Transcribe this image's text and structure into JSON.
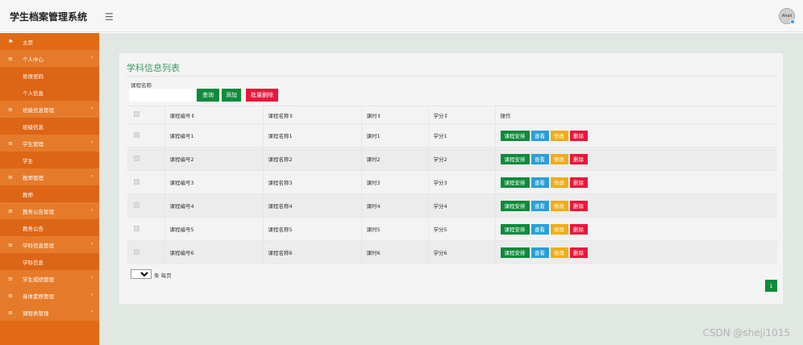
{
  "header": {
    "app_title": "学生档案管理系统",
    "menu_icon": "hamburger-icon",
    "avatar_text": "Ahaii"
  },
  "sidebar": {
    "items": [
      {
        "type": "home",
        "label": "主页",
        "icon": "flag-icon"
      },
      {
        "type": "group",
        "label": "个人中心",
        "icon": "menu-icon"
      },
      {
        "type": "sub",
        "label": "修改密码"
      },
      {
        "type": "sub",
        "label": "个人信息"
      },
      {
        "type": "group",
        "label": "班级信息管理",
        "icon": "menu-icon"
      },
      {
        "type": "sub",
        "label": "班级信息"
      },
      {
        "type": "group",
        "label": "学生管理",
        "icon": "menu-icon"
      },
      {
        "type": "sub",
        "label": "学生"
      },
      {
        "type": "group",
        "label": "教师管理",
        "icon": "menu-icon"
      },
      {
        "type": "sub",
        "label": "教师"
      },
      {
        "type": "group",
        "label": "教务公告管理",
        "icon": "menu-icon"
      },
      {
        "type": "sub",
        "label": "教务公告"
      },
      {
        "type": "group",
        "label": "学科信息管理",
        "icon": "menu-icon"
      },
      {
        "type": "sub",
        "label": "学科信息"
      },
      {
        "type": "group",
        "label": "学生成绩管理",
        "icon": "menu-icon"
      },
      {
        "type": "group",
        "label": "身体素质管理",
        "icon": "menu-icon"
      },
      {
        "type": "group",
        "label": "课程表管理",
        "icon": "menu-icon"
      }
    ]
  },
  "main": {
    "title": "学科信息列表",
    "search": {
      "label": "课程名称",
      "value": "",
      "placeholder": ""
    },
    "buttons": {
      "query": "查询",
      "add": "添加",
      "batch_delete": "批量删除"
    },
    "table": {
      "columns": [
        "",
        "课程编号⇕",
        "课程名称⇕",
        "课时⇕",
        "学分⇕",
        "操作"
      ],
      "rows": [
        {
          "code": "课程编号1",
          "name": "课程名称1",
          "hours": "课时1",
          "credit": "学分1"
        },
        {
          "code": "课程编号2",
          "name": "课程名称2",
          "hours": "课时2",
          "credit": "学分2"
        },
        {
          "code": "课程编号3",
          "name": "课程名称3",
          "hours": "课时3",
          "credit": "学分3"
        },
        {
          "code": "课程编号4",
          "name": "课程名称4",
          "hours": "课时4",
          "credit": "学分4"
        },
        {
          "code": "课程编号5",
          "name": "课程名称5",
          "hours": "课时5",
          "credit": "学分5"
        },
        {
          "code": "课程编号6",
          "name": "课程名称6",
          "hours": "课时6",
          "credit": "学分6"
        }
      ],
      "row_actions": {
        "plan": "课程安排",
        "view": "查看",
        "edit": "修改",
        "delete": "删除"
      }
    },
    "pagination": {
      "page_size": "10",
      "per_page_text": "条 每页",
      "current_page": "1"
    }
  },
  "watermark": "CSDN @sheji1015",
  "colors": {
    "sidebar": "#e26a17",
    "primary": "#0f8a3c",
    "danger": "#e6183c",
    "info": "#2a9fd6",
    "warning": "#f0ad19",
    "title": "#3a9b60"
  }
}
